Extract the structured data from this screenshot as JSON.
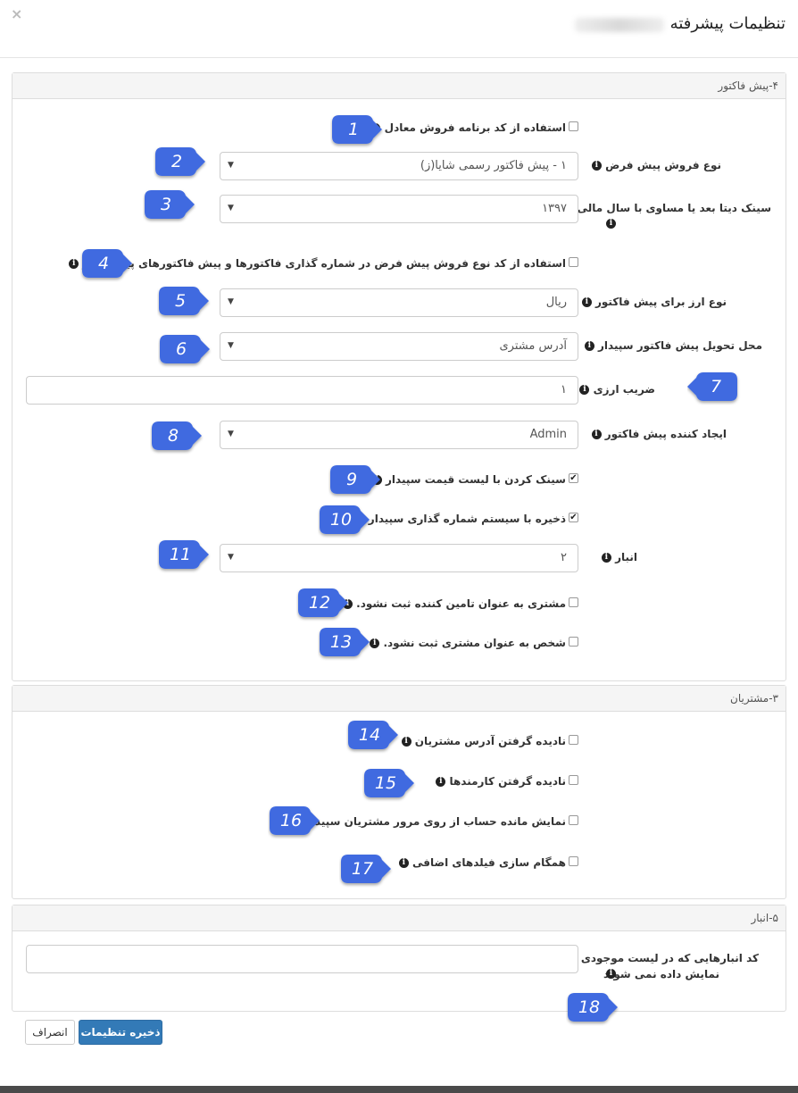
{
  "dialog": {
    "title": "تنظیمات پیشرفته",
    "close_icon": "×"
  },
  "sections": {
    "invoice": {
      "title": "۴-پیش فاکتور"
    },
    "customers": {
      "title": "۳-مشتریان"
    },
    "warehouse": {
      "title": "۵-انبار"
    }
  },
  "fields": {
    "f1": {
      "label": "استفاده از کد برنامه فروش معادل",
      "checked": false
    },
    "f2": {
      "label": "نوع فروش پیش فرض",
      "value": "۱ - پیش فاکتور رسمی شایا(ز)"
    },
    "f3": {
      "label_line1": "سینک دیتا بعد یا مساوی با سال مالی",
      "value": "۱۳۹۷"
    },
    "f4": {
      "label": "استفاده از کد نوع فروش پیش فرض در شماره گذاری فاکتورها و پیش فاکتورهای پیام گستر",
      "checked": false
    },
    "f5": {
      "label": "نوع ارز برای پیش فاکتور",
      "value": "ریال"
    },
    "f6": {
      "label": "محل تحویل پیش فاکتور سپیدار",
      "value": "آدرس مشتری"
    },
    "f7": {
      "label": "ضریب ارزی",
      "value": "۱"
    },
    "f8": {
      "label": "ایجاد کننده پیش فاکتور",
      "value": "Admin"
    },
    "f9": {
      "label": "سینک کردن با لیست قیمت سپیدار",
      "checked": true
    },
    "f10": {
      "label": "ذخیره با سیستم شماره گذاری سپیدار",
      "checked": true
    },
    "f11": {
      "label": "انبار",
      "value": "۲"
    },
    "f12": {
      "label": "مشتری به عنوان تامین کننده ثبت نشود.",
      "checked": false
    },
    "f13": {
      "label": "شخص به عنوان مشتری ثبت نشود.",
      "checked": false
    },
    "f14": {
      "label": "نادیده گرفتن آدرس مشتریان",
      "checked": false
    },
    "f15": {
      "label": "نادیده گرفتن کارمندها",
      "checked": false
    },
    "f16": {
      "label": "نمایش مانده حساب از روی مرور مشتریان سپیدار",
      "checked": false
    },
    "f17": {
      "label": "همگام سازی فیلدهای اضافی",
      "checked": false
    },
    "f18": {
      "label_line1": "کد انبارهایی که در لیست موجودی",
      "label_line2": "نمایش داده نمی شوند",
      "value": ""
    }
  },
  "badges": [
    "1",
    "2",
    "3",
    "4",
    "5",
    "6",
    "7",
    "8",
    "9",
    "10",
    "11",
    "12",
    "13",
    "14",
    "15",
    "16",
    "17",
    "18"
  ],
  "buttons": {
    "save": "ذخیره تنظیمات",
    "cancel": "انصراف"
  },
  "colors": {
    "badge": "#3f6ae0",
    "primary": "#337ab7"
  },
  "icons": {
    "info": "i",
    "arrow": "▼",
    "check": "✔"
  }
}
